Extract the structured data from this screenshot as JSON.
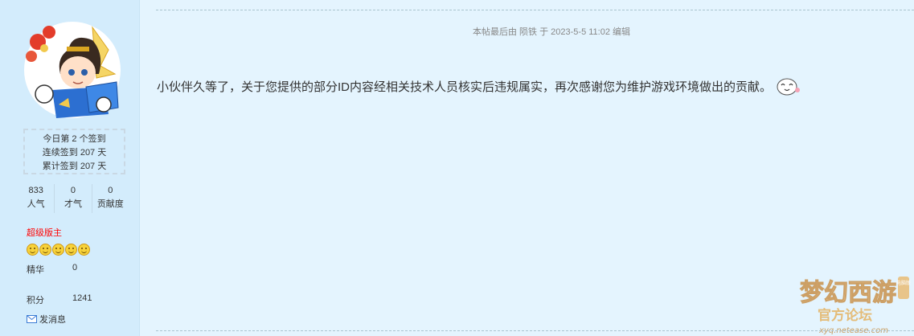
{
  "sidebar": {
    "sign": {
      "line1": "今日第 2 个签到",
      "line2": "连续签到 207 天",
      "line3": "累计签到 207 天"
    },
    "stats": [
      {
        "value": "833",
        "label": "人气"
      },
      {
        "value": "0",
        "label": "才气"
      },
      {
        "value": "0",
        "label": "贡献度"
      }
    ],
    "rank": "超级版主",
    "rank_faces": 5,
    "essence_label": "精华",
    "essence_value": "0",
    "points_label": "积分",
    "points_value": "1241",
    "send_message": "发消息"
  },
  "post": {
    "edit_note": "本帖最后由 陨铁 于 2023-5-5 11:02 编辑",
    "content": "小伙伴久等了，关于您提供的部分ID内容经相关技术人员核实后违规属实，再次感谢您为维护游戏环境做出的贡献。"
  },
  "watermark": {
    "title_main": "梦幻西游",
    "badge": "电脑版",
    "title_sub": "官方论坛",
    "url": "xyq.netease.com"
  },
  "colors": {
    "sidebar_bg": "#d3ecfc",
    "main_bg": "#e4f4fe",
    "rank_red": "#ff0000"
  }
}
